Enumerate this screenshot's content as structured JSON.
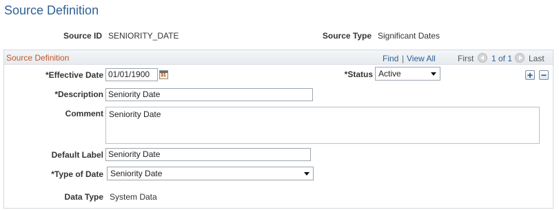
{
  "page": {
    "title": "Source Definition"
  },
  "summary": {
    "source_id_label": "Source ID",
    "source_id_value": "SENIORITY_DATE",
    "source_type_label": "Source Type",
    "source_type_value": "Significant Dates"
  },
  "group": {
    "title": "Source Definition",
    "find_link": "Find",
    "separator": "|",
    "view_all_link": "View All",
    "first_label": "First",
    "range_text": "1 of 1",
    "last_label": "Last"
  },
  "form": {
    "effective_date_label": "*Effective Date",
    "effective_date_value": "01/01/1900",
    "calendar_icon_text": "31",
    "status_label": "*Status",
    "status_value": "Active",
    "add_row_symbol": "+",
    "delete_row_symbol": "−",
    "description_label": "*Description",
    "description_value": "Seniority Date",
    "comment_label": "Comment",
    "comment_value": "Seniority Date",
    "default_label_label": "Default Label",
    "default_label_value": "Seniority Date",
    "type_of_date_label": "*Type of Date",
    "type_of_date_value": "Seniority Date",
    "data_type_label": "Data Type",
    "data_type_value": "System Data"
  }
}
